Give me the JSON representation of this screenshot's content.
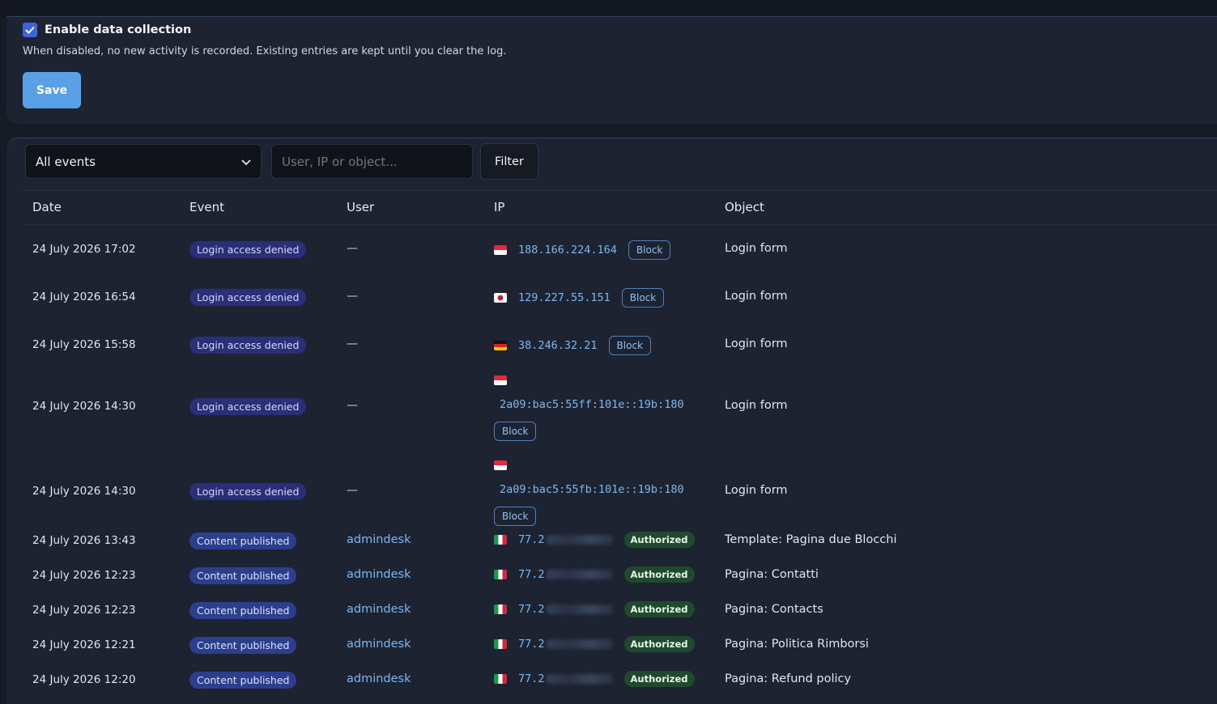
{
  "settings": {
    "checkbox_label": "Enable data collection",
    "checked": true,
    "help_text": "When disabled, no new activity is recorded. Existing entries are kept until you clear the log.",
    "save_label": "Save"
  },
  "filters": {
    "event_select": "All events",
    "search_placeholder": "User, IP or object...",
    "filter_label": "Filter"
  },
  "table": {
    "columns": [
      "Date",
      "Event",
      "User",
      "IP",
      "Object"
    ],
    "rows": [
      {
        "date": "24 July 2026 17:02",
        "event": "Login access denied",
        "event_type": "denied",
        "user": "—",
        "flag": "sg-flag-icon",
        "ip": "188.166.224.164",
        "action": "Block",
        "object": "Login form"
      },
      {
        "date": "24 July 2026 16:54",
        "event": "Login access denied",
        "event_type": "denied",
        "user": "—",
        "flag": "jp-flag-icon",
        "ip": "129.227.55.151",
        "action": "Block",
        "object": "Login form"
      },
      {
        "date": "24 July 2026 15:58",
        "event": "Login access denied",
        "event_type": "denied",
        "user": "—",
        "flag": "de-flag-icon",
        "ip": "38.246.32.21",
        "action": "Block",
        "object": "Login form"
      },
      {
        "date": "24 July 2026 14:30",
        "event": "Login access denied",
        "event_type": "denied",
        "user": "—",
        "flag": "sg-flag-icon",
        "ip": "2a09:bac5:55ff:101e::19b:180",
        "action": "Block",
        "object": "Login form"
      },
      {
        "date": "24 July 2026 14:30",
        "event": "Login access denied",
        "event_type": "denied",
        "user": "—",
        "flag": "sg-flag-icon",
        "ip": "2a09:bac5:55fb:101e::19b:180",
        "action": "Block",
        "object": "Login form"
      },
      {
        "date": "24 July 2026 13:43",
        "event": "Content published",
        "event_type": "published",
        "user": "admindesk",
        "flag": "it-flag-icon",
        "ip": "77.2",
        "action": "Authorized",
        "object": "Template: Pagina due Blocchi"
      },
      {
        "date": "24 July 2026 12:23",
        "event": "Content published",
        "event_type": "published",
        "user": "admindesk",
        "flag": "it-flag-icon",
        "ip": "77.2",
        "action": "Authorized",
        "object": "Pagina: Contatti"
      },
      {
        "date": "24 July 2026 12:23",
        "event": "Content published",
        "event_type": "published",
        "user": "admindesk",
        "flag": "it-flag-icon",
        "ip": "77.2",
        "action": "Authorized",
        "object": "Pagina: Contacts"
      },
      {
        "date": "24 July 2026 12:21",
        "event": "Content published",
        "event_type": "published",
        "user": "admindesk",
        "flag": "it-flag-icon",
        "ip": "77.2",
        "action": "Authorized",
        "object": "Pagina: Politica Rimborsi"
      },
      {
        "date": "24 July 2026 12:20",
        "event": "Content published",
        "event_type": "published",
        "user": "admindesk",
        "flag": "it-flag-icon",
        "ip": "77.2",
        "action": "Authorized",
        "object": "Pagina: Refund policy"
      }
    ]
  },
  "colors": {
    "accent": "#3d63dd",
    "save_button": "#5aa0e6",
    "denied_badge": "#2b2f78",
    "published_badge": "#2b3f8e",
    "authorized_badge": "#1f4a2d",
    "link": "#7cb6f0"
  }
}
